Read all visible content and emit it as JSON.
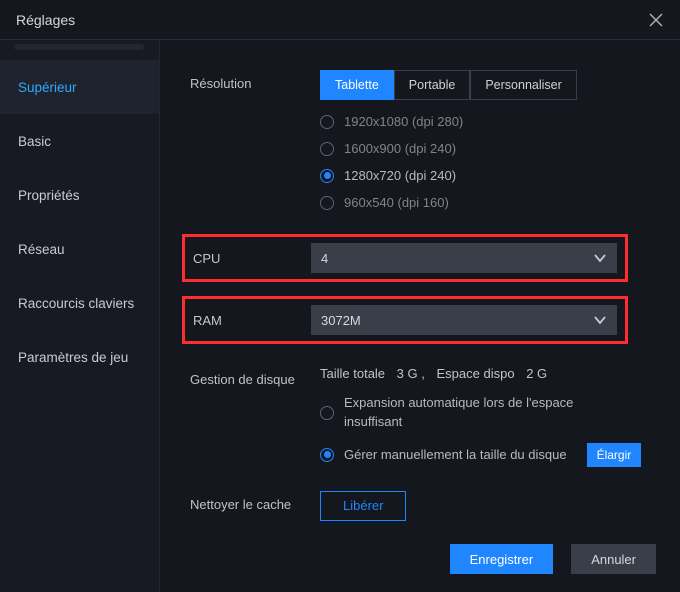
{
  "window": {
    "title": "Réglages"
  },
  "sidebar": {
    "items": [
      {
        "label": "Supérieur"
      },
      {
        "label": "Basic"
      },
      {
        "label": "Propriétés"
      },
      {
        "label": "Réseau"
      },
      {
        "label": "Raccourcis claviers"
      },
      {
        "label": "Paramètres de jeu"
      }
    ]
  },
  "resolution": {
    "label": "Résolution",
    "tabs": {
      "tablet": "Tablette",
      "portable": "Portable",
      "custom": "Personnaliser"
    },
    "options": [
      {
        "text": "1920x1080  (dpi 280)"
      },
      {
        "text": "1600x900  (dpi 240)"
      },
      {
        "text": "1280x720  (dpi 240)"
      },
      {
        "text": "960x540  (dpi 160)"
      }
    ]
  },
  "cpu": {
    "label": "CPU",
    "value": "4"
  },
  "ram": {
    "label": "RAM",
    "value": "3072M"
  },
  "disk": {
    "label": "Gestion de disque",
    "total_label": "Taille totale",
    "total_value": "3 G",
    "sep": ",",
    "free_label": "Espace dispo",
    "free_value": "2 G",
    "opt_auto_l1": "Expansion automatique lors de l'espace",
    "opt_auto_l2": "insuffisant",
    "opt_manual": "Gérer manuellement la taille du disque",
    "expand_btn": "Élargir"
  },
  "cache": {
    "label": "Nettoyer le cache",
    "btn": "Libérer"
  },
  "footer": {
    "save": "Enregistrer",
    "cancel": "Annuler"
  }
}
